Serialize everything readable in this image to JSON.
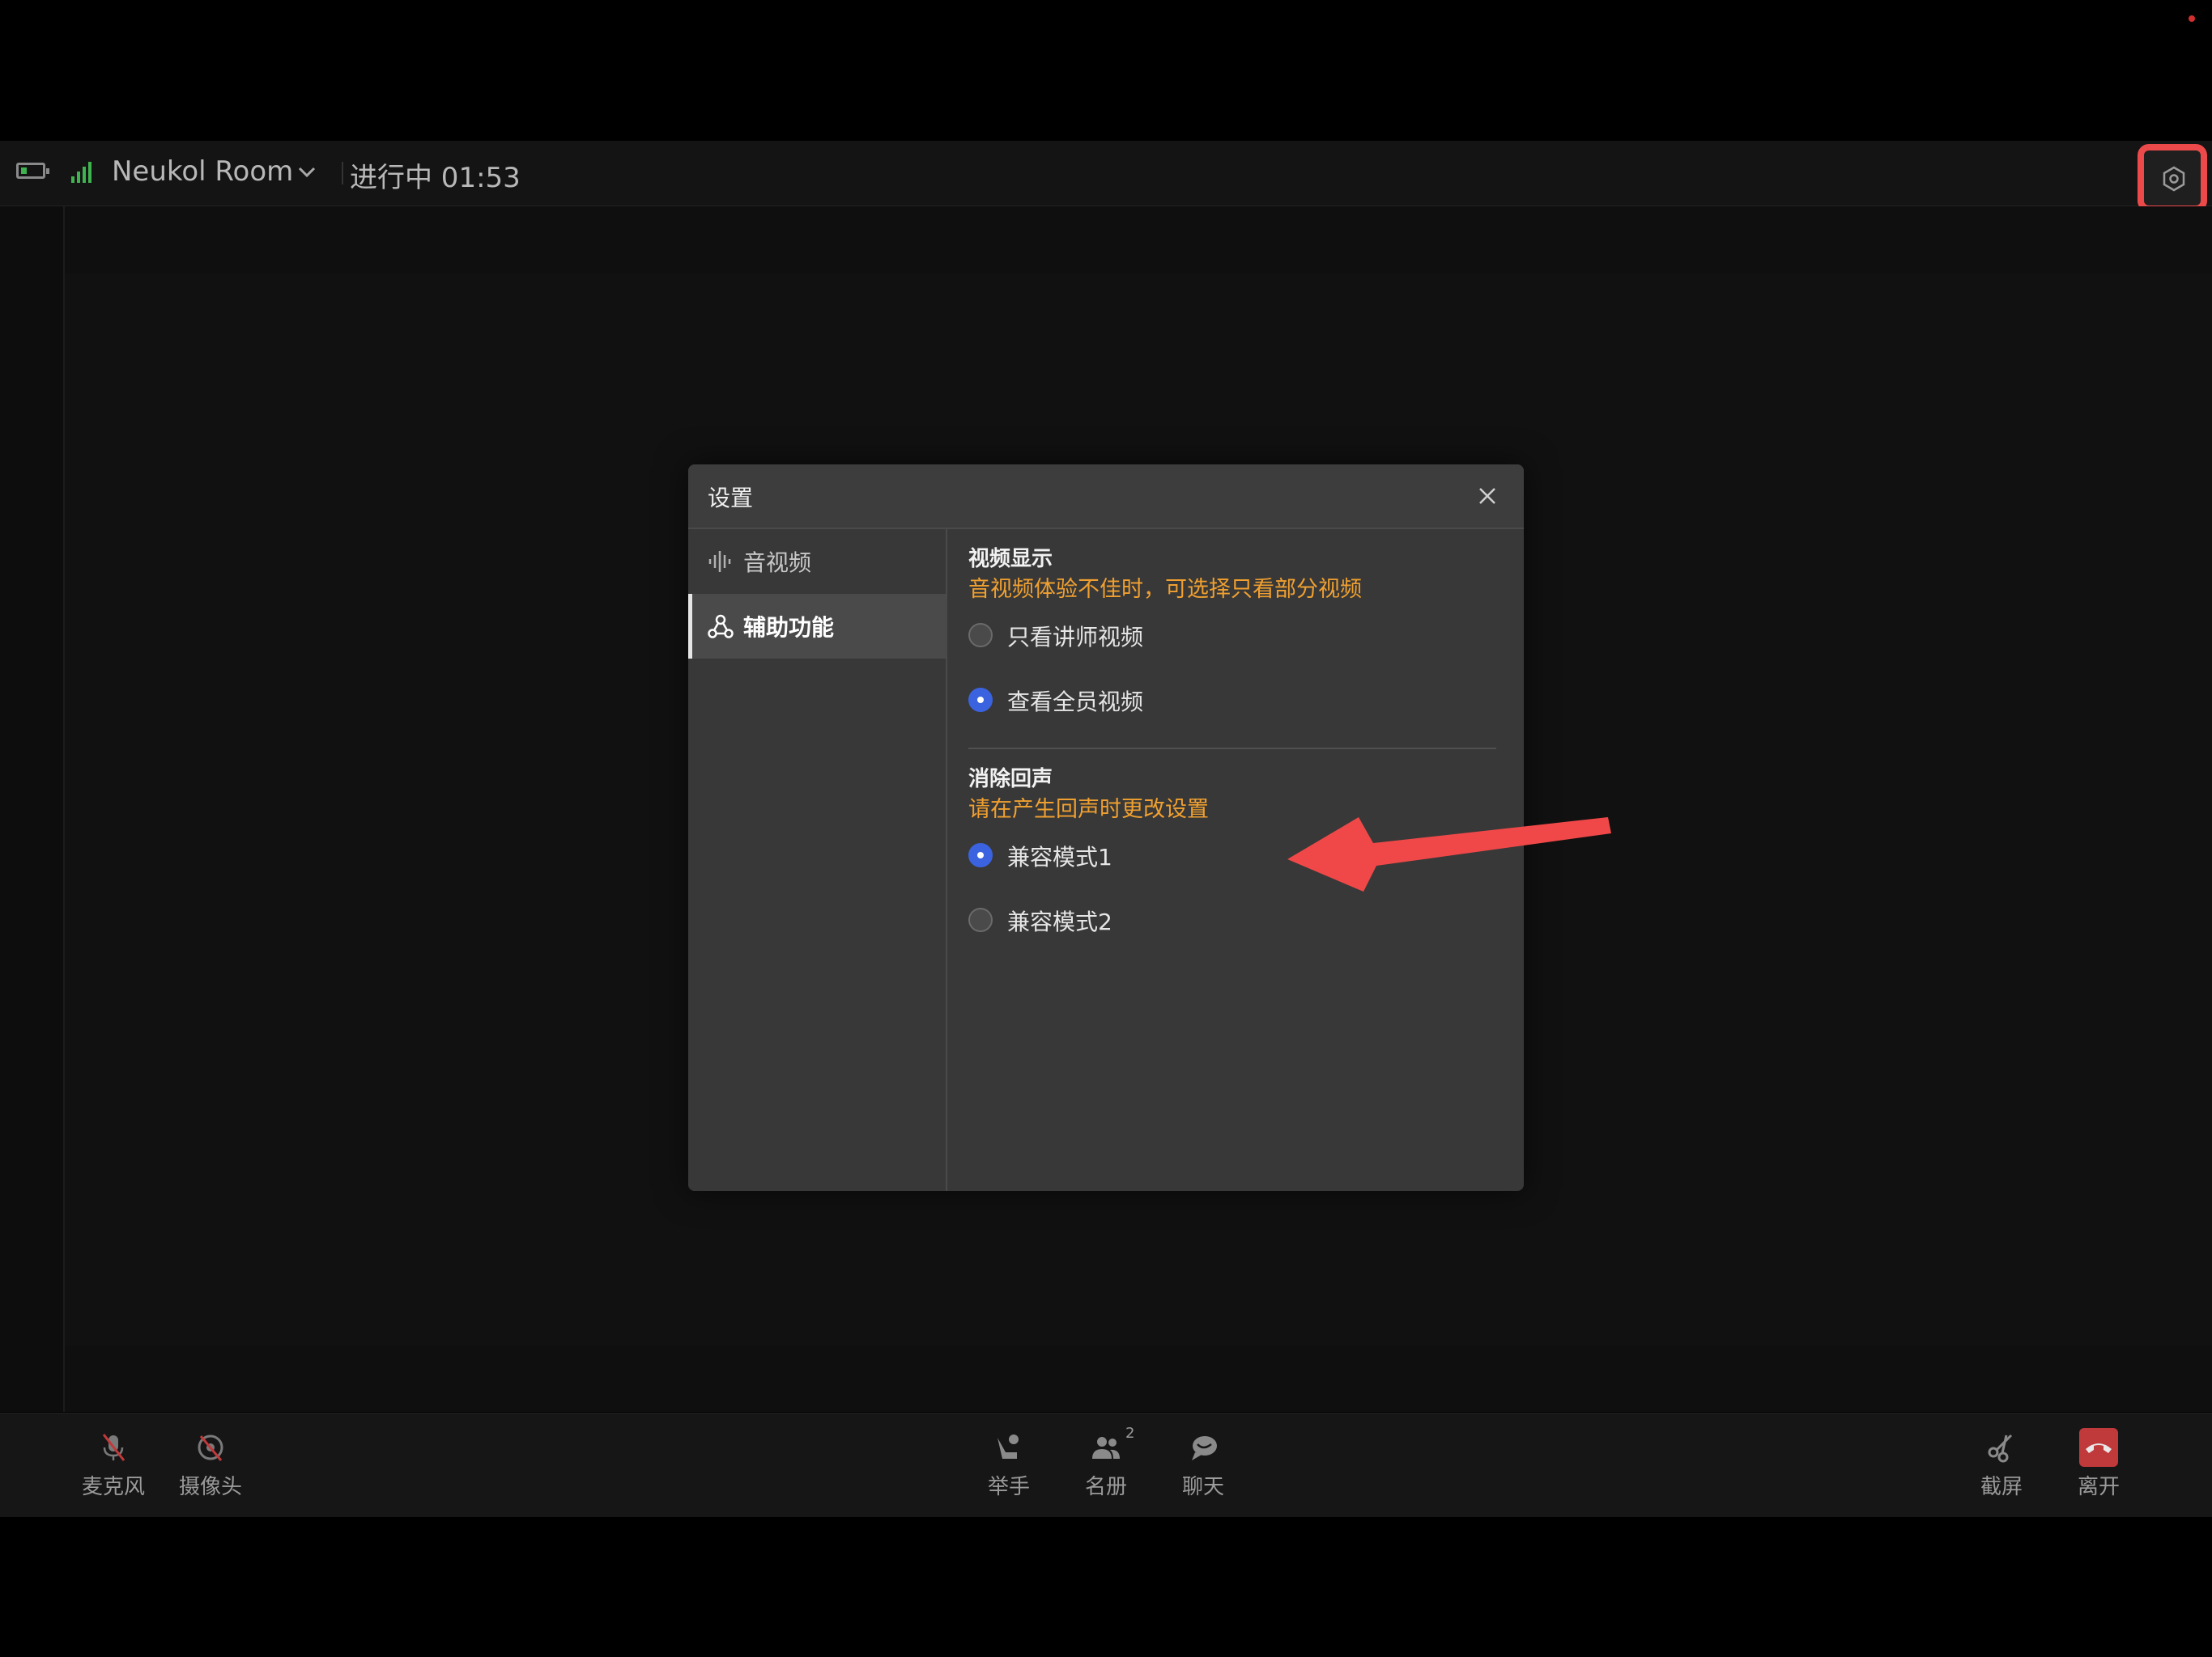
{
  "topbar": {
    "room_name": "Neukol Room",
    "status": "进行中 01:53",
    "settings_highlight_color": "#ec4a4a"
  },
  "dialog": {
    "title": "设置",
    "sidebar": {
      "items": [
        {
          "label": "音视频",
          "icon": "audio-wave-icon",
          "active": false
        },
        {
          "label": "辅助功能",
          "icon": "accessibility-icon",
          "active": true
        }
      ]
    },
    "sections": [
      {
        "title": "视频显示",
        "hint": "音视频体验不佳时，可选择只看部分视频",
        "options": [
          {
            "label": "只看讲师视频",
            "selected": false
          },
          {
            "label": "查看全员视频",
            "selected": true
          }
        ]
      },
      {
        "title": "消除回声",
        "hint": "请在产生回声时更改设置",
        "options": [
          {
            "label": "兼容模式1",
            "selected": true
          },
          {
            "label": "兼容模式2",
            "selected": false
          }
        ]
      }
    ]
  },
  "toolbar": {
    "mic_label": "麦克风",
    "camera_label": "摄像头",
    "raise_hand_label": "举手",
    "roster_label": "名册",
    "roster_count": "2",
    "chat_label": "聊天",
    "screenshot_label": "截屏",
    "leave_label": "离开"
  },
  "colors": {
    "hint": "#f0a030",
    "radio_selected": "#3b63e0",
    "leave": "#c0393b",
    "annotation": "#f04848"
  }
}
